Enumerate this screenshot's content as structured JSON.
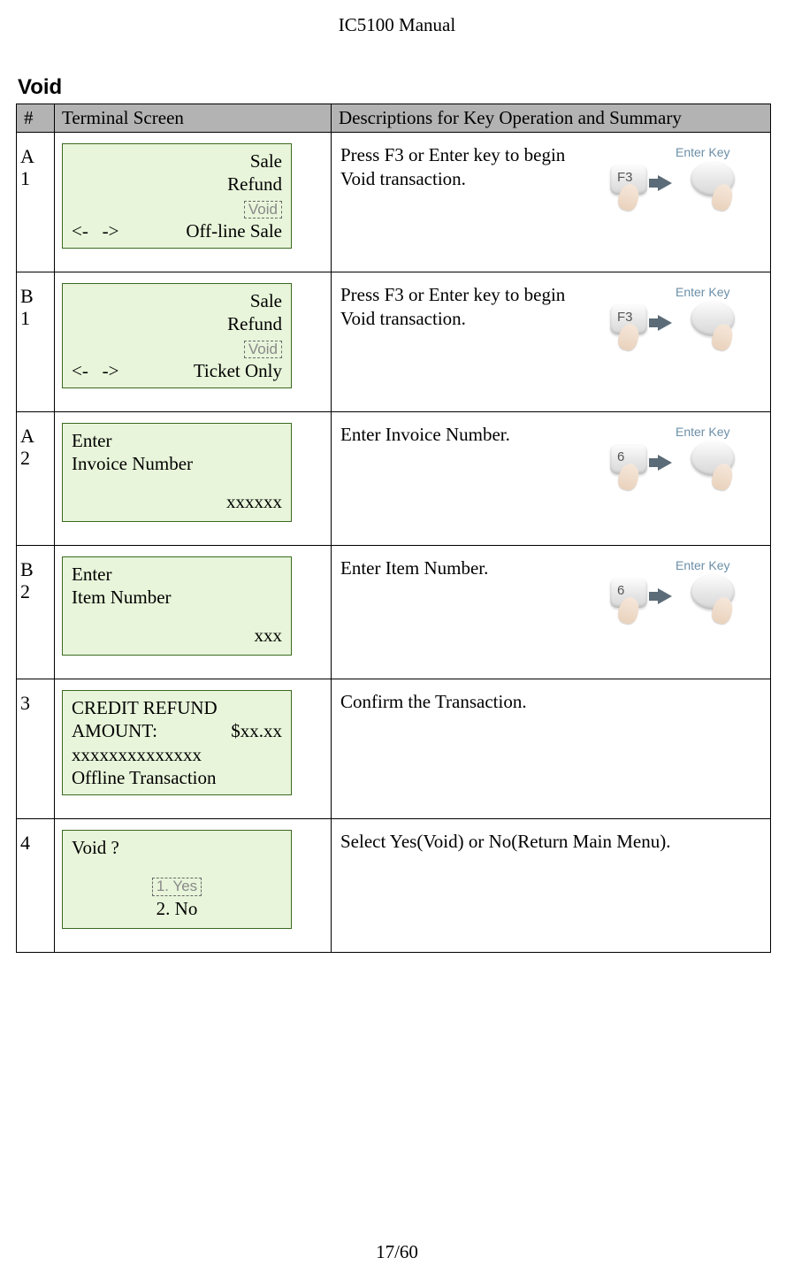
{
  "header": {
    "title": "IC5100 Manual"
  },
  "section": {
    "title": "Void"
  },
  "table": {
    "columns": {
      "id": "#",
      "screen": "Terminal Screen",
      "desc": "Descriptions for Key Operation and Summary"
    },
    "rows": [
      {
        "id_prefix": "A",
        "id_num": "1",
        "screen": {
          "line1": "Sale",
          "line2": "Refund",
          "void_label": "Void",
          "nav_left": "<-   ->",
          "nav_right": "Off-line Sale"
        },
        "desc": "Press F3 or Enter key to begin Void transaction.",
        "key": {
          "enter_label": "Enter Key",
          "left_glyph": "F3",
          "show_image": true
        }
      },
      {
        "id_prefix": "B",
        "id_num": "1",
        "screen": {
          "line1": "Sale",
          "line2": "Refund",
          "void_label": "Void",
          "nav_left": "<-   ->",
          "nav_right": "Ticket Only"
        },
        "desc": "Press F3 or Enter key to begin Void transaction.",
        "key": {
          "enter_label": "Enter Key",
          "left_glyph": "F3",
          "show_image": true
        }
      },
      {
        "id_prefix": "A",
        "id_num": "2",
        "screen": {
          "lineA": "Enter",
          "lineB": "Invoice Number",
          "value": "xxxxxx"
        },
        "desc": "Enter Invoice Number.",
        "key": {
          "enter_label": "Enter Key",
          "left_glyph": "6",
          "show_image": true
        }
      },
      {
        "id_prefix": "B",
        "id_num": "2",
        "screen": {
          "lineA": "Enter",
          "lineB": "Item Number",
          "value": "xxx"
        },
        "desc": "Enter Item Number.",
        "key": {
          "enter_label": "Enter Key",
          "left_glyph": "6",
          "show_image": true
        }
      },
      {
        "id_prefix": "",
        "id_num": "3",
        "screen": {
          "l1": "CREDIT REFUND",
          "l2a": "AMOUNT:",
          "l2b": "$xx.xx",
          "l3": "xxxxxxxxxxxxxx",
          "l4": "Offline Transaction"
        },
        "desc": "Confirm the Transaction.",
        "key": {
          "show_image": false
        }
      },
      {
        "id_prefix": "",
        "id_num": "4",
        "screen": {
          "prompt": "Void ?",
          "yes_label": "1. Yes",
          "no_label": "2. No"
        },
        "desc": "Select Yes(Void) or No(Return Main Menu).",
        "key": {
          "show_image": false
        }
      }
    ]
  },
  "footer": {
    "page": "17/60"
  }
}
